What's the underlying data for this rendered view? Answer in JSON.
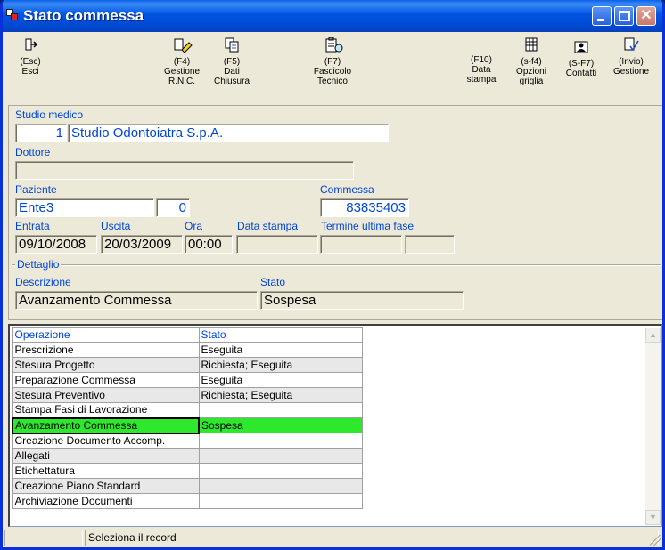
{
  "window": {
    "title": "Stato commessa"
  },
  "toolbar": [
    {
      "key": "(Esc)",
      "label": "Esci",
      "icon": "exit-icon"
    },
    {
      "key": "(F4)",
      "label": "Gestione\nR.N.C.",
      "icon": "edit-pencil-icon"
    },
    {
      "key": "(F5)",
      "label": "Dati\nChiusura",
      "icon": "copy-icon"
    },
    {
      "key": "(F7)",
      "label": "Fascicolo\nTecnico",
      "icon": "clipboard-search-icon"
    },
    {
      "key": "(F10)",
      "label": "Data\nstampa",
      "icon": ""
    },
    {
      "key": "(s-f4)",
      "label": "Opzioni\ngriglia",
      "icon": "grid-options-icon"
    },
    {
      "key": "(S-F7)",
      "label": "Contatti",
      "icon": "contacts-icon"
    },
    {
      "key": "(Invio)",
      "label": "Gestione",
      "icon": "document-check-icon"
    }
  ],
  "form": {
    "studio_label": "Studio medico",
    "studio_code": "1",
    "studio_name": "Studio Odontoiatra S.p.A.",
    "dottore_label": "Dottore",
    "dottore_value": "",
    "paziente_label": "Paziente",
    "paziente_value": "Ente3",
    "paziente_num": "0",
    "commessa_label": "Commessa",
    "commessa_value": "83835403",
    "entrata_label": "Entrata",
    "entrata_value": "09/10/2008",
    "uscita_label": "Uscita",
    "uscita_value": "20/03/2009",
    "ora_label": "Ora",
    "ora_value": "00:00",
    "data_stampa_label": "Data stampa",
    "data_stampa_value": "",
    "termine_label": "Termine ultima fase",
    "termine_value1": "",
    "termine_value2": ""
  },
  "dettaglio": {
    "title": "Dettaglio",
    "descrizione_label": "Descrizione",
    "descrizione_value": "Avanzamento Commessa",
    "stato_label": "Stato",
    "stato_value": "Sospesa"
  },
  "grid": {
    "headers": [
      "Operazione",
      "Stato"
    ],
    "rows": [
      [
        "Prescrizione",
        "Eseguita"
      ],
      [
        "Stesura Progetto",
        "Richiesta; Eseguita"
      ],
      [
        "Preparazione Commessa",
        "Eseguita"
      ],
      [
        "Stesura Preventivo",
        "Richiesta; Eseguita"
      ],
      [
        "Stampa Fasi di Lavorazione",
        ""
      ],
      [
        "Avanzamento Commessa",
        "Sospesa"
      ],
      [
        "Creazione Documento Accomp.",
        ""
      ],
      [
        "Allegati",
        ""
      ],
      [
        "Etichettatura",
        ""
      ],
      [
        "Creazione Piano Standard",
        ""
      ],
      [
        "Archiviazione Documenti",
        ""
      ]
    ],
    "selected_index": 5,
    "selected_color": "#2EE82E"
  },
  "status": {
    "message": "Seleziona il record"
  }
}
